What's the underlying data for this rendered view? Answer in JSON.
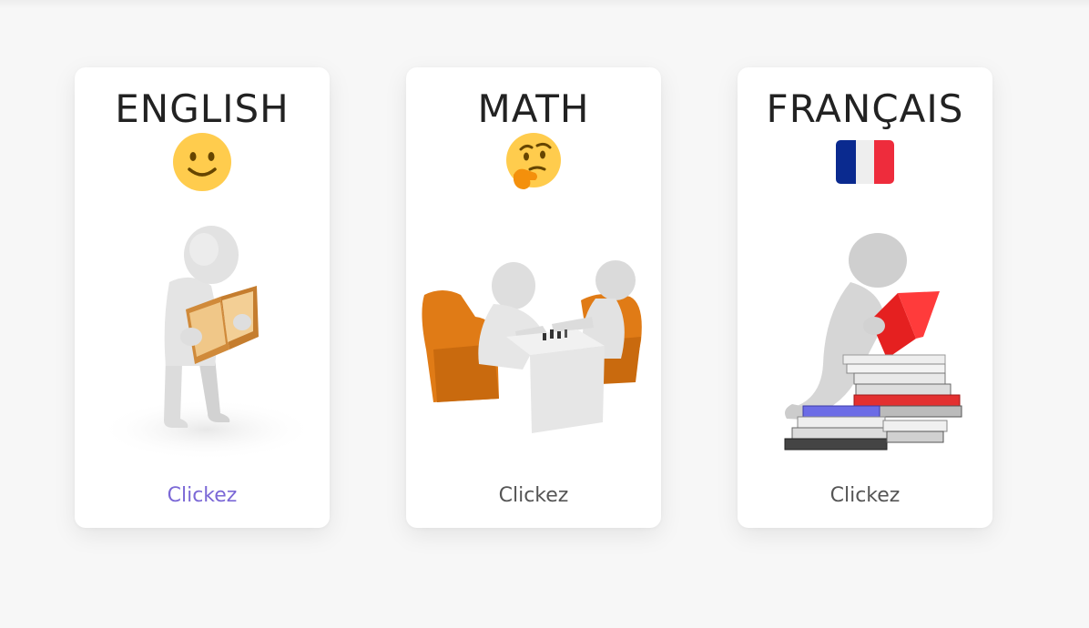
{
  "cards": [
    {
      "title": "ENGLISH",
      "emoji": "slightly-smiling-face-icon",
      "illustration": "person-reading-book",
      "cta": "Clickez",
      "cta_color": "#7b68d6"
    },
    {
      "title": "MATH",
      "emoji": "thinking-face-icon",
      "illustration": "people-playing-chess",
      "cta": "Clickez",
      "cta_color": "#555555"
    },
    {
      "title": "FRANÇAIS",
      "emoji": "france-flag-icon",
      "illustration": "person-with-book-stack",
      "cta": "Clickez",
      "cta_color": "#555555"
    }
  ],
  "colors": {
    "background": "#f7f7f7",
    "card": "#ffffff",
    "title": "#222222",
    "accent": "#7b68d6",
    "flag_blue": "#0a2a8f",
    "flag_red": "#ee2c3c"
  }
}
